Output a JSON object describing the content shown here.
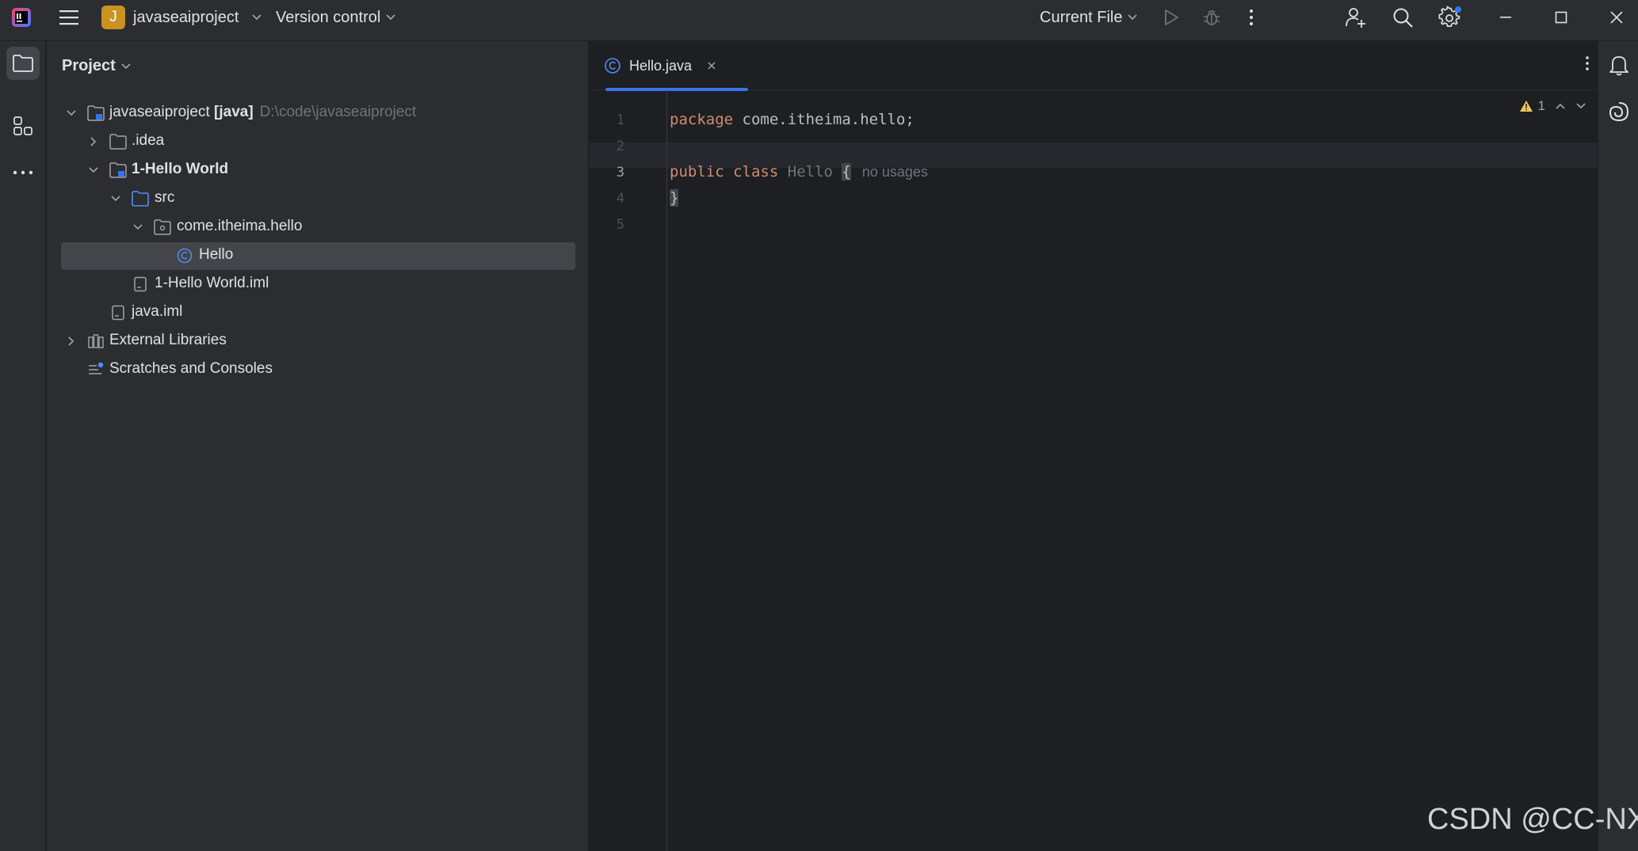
{
  "titlebar": {
    "project_badge": "J",
    "project_name": "javaseaiproject",
    "vcs_label": "Version control",
    "run_config": "Current File"
  },
  "project_panel": {
    "title": "Project",
    "tree": [
      {
        "label": "javaseaiproject",
        "tag": "[java]",
        "path": "D:\\code\\javaseaiproject"
      },
      {
        "label": ".idea"
      },
      {
        "label": "1-Hello World"
      },
      {
        "label": "src"
      },
      {
        "label": "come.itheima.hello"
      },
      {
        "label": "Hello"
      },
      {
        "label": "1-Hello World.iml"
      },
      {
        "label": "java.iml"
      },
      {
        "label": "External Libraries"
      },
      {
        "label": "Scratches and Consoles"
      }
    ]
  },
  "editor": {
    "tab_label": "Hello.java",
    "line_numbers": [
      "1",
      "2",
      "3",
      "4",
      "5"
    ],
    "code": {
      "l1_kw": "package",
      "l1_rest": " come.itheima.hello;",
      "l3_kw1": "public",
      "l3_kw2": "class",
      "l3_name": "Hello",
      "l3_brace": "{",
      "l3_hint": "no usages",
      "l4_brace": "}"
    },
    "warning_count": "1"
  },
  "watermark": "CSDN @CC-NX",
  "colors": {
    "accent": "#3574f0",
    "keyword": "#cf8e6d",
    "warning": "#f2c55c",
    "badge": "#c89320"
  }
}
